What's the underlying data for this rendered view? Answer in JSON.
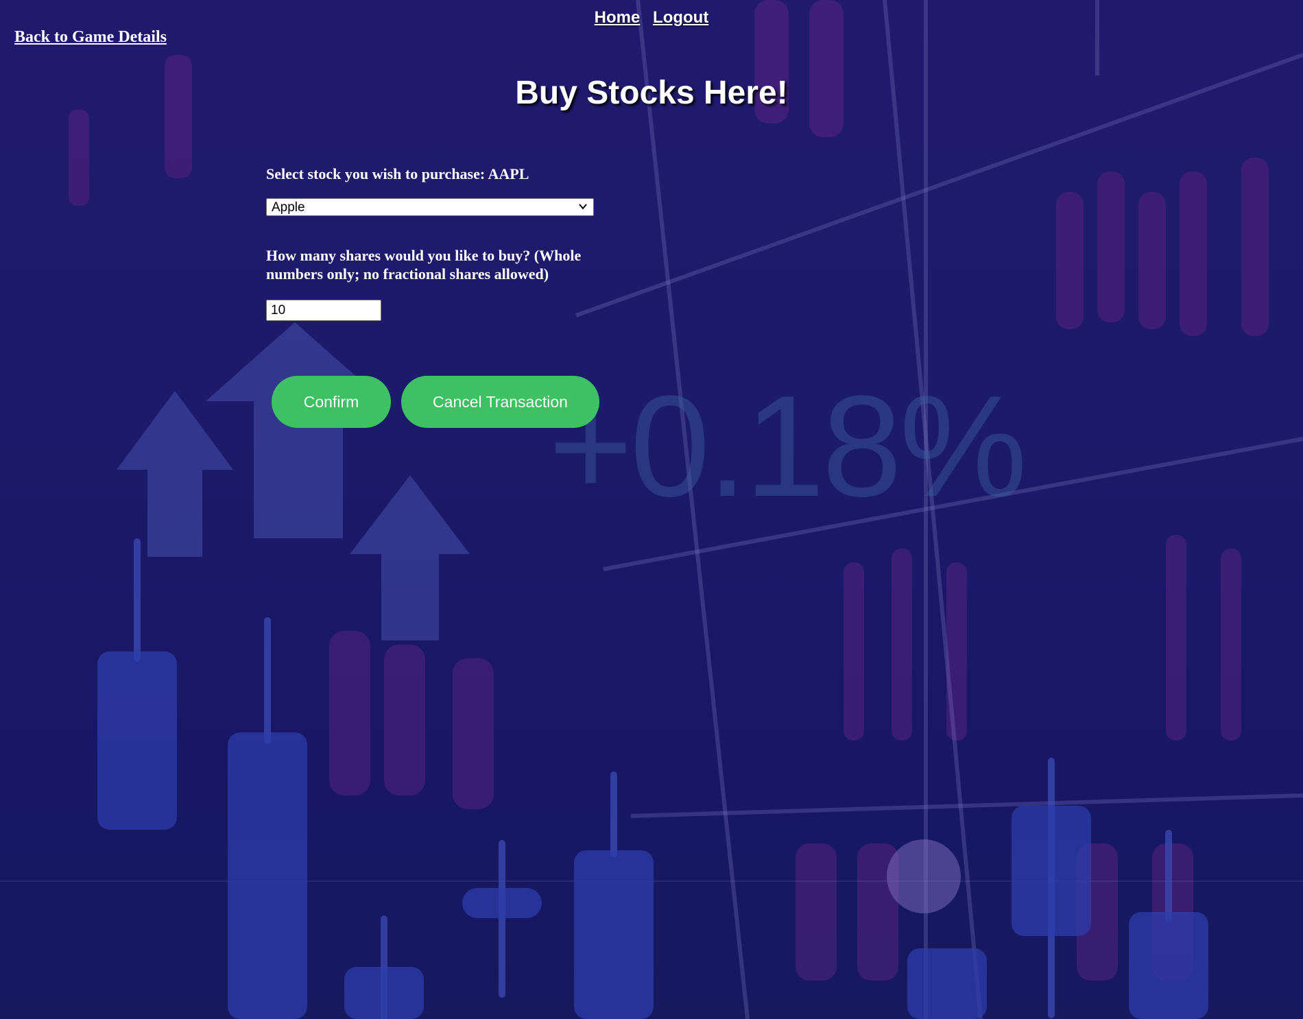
{
  "nav": {
    "home_label": "Home",
    "logout_label": "Logout",
    "back_label": "Back to Game Details"
  },
  "page": {
    "title": "Buy Stocks Here!"
  },
  "form": {
    "select_label": "Select stock you wish to purchase: AAPL",
    "selected_stock": "Apple",
    "quantity_label": "How many shares would you like to buy? (Whole numbers only; no fractional shares allowed)",
    "quantity_value": "10"
  },
  "buttons": {
    "confirm_label": "Confirm",
    "cancel_label": "Cancel Transaction"
  },
  "background": {
    "percent_text": "+0.18%"
  },
  "colors": {
    "background": "#1c1a6a",
    "button": "#3ec162",
    "text": "#ffffff"
  }
}
